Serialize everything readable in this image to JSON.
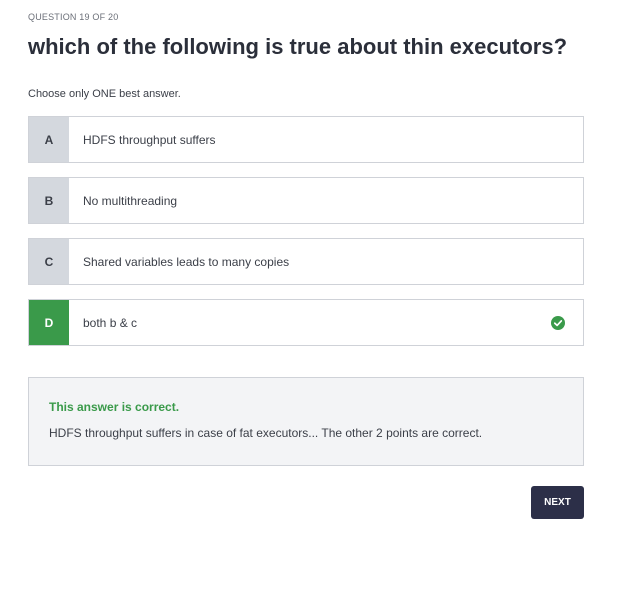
{
  "header": {
    "counter": "QUESTION 19 OF 20",
    "title": "which of the following is true about thin executors?",
    "instructions": "Choose only ONE best answer."
  },
  "options": [
    {
      "letter": "A",
      "text": "HDFS throughput suffers",
      "selected": false
    },
    {
      "letter": "B",
      "text": "No multithreading",
      "selected": false
    },
    {
      "letter": "C",
      "text": "Shared variables leads to many copies",
      "selected": false
    },
    {
      "letter": "D",
      "text": "both b & c",
      "selected": true,
      "icon": "check-circle-icon"
    }
  ],
  "feedback": {
    "title": "This answer is correct.",
    "text": "HDFS throughput suffers in case of fat executors... The other 2 points are correct."
  },
  "actions": {
    "next_label": "NEXT"
  },
  "colors": {
    "correct": "#3a9a4a",
    "letter_bg": "#d4d8de",
    "button_bg": "#2c2f48",
    "border": "#cfd2d8",
    "feedback_bg": "#f3f4f6"
  }
}
